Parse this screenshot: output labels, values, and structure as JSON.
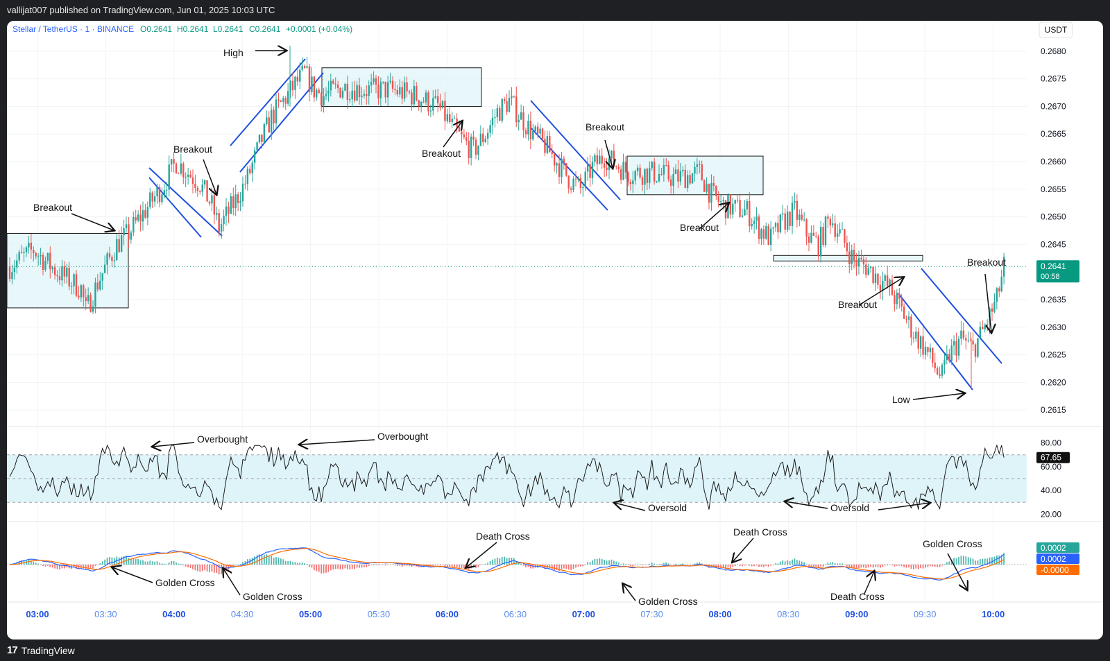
{
  "published_line": "vallijat007 published on TradingView.com, Jun 01, 2025 10:03 UTC",
  "footer_brand": "TradingView",
  "footer_logo_text": "17",
  "colors": {
    "up": "#26a69a",
    "down": "#ef5350",
    "channel": "#1e4fe0",
    "box": "#dff4f8",
    "accent_price": "#089981",
    "macd_fast": "#2962ff",
    "macd_slow": "#ff6d00",
    "rsi_band": "#dff4f8"
  },
  "chart_data": [
    {
      "type": "candlestick",
      "title": "Stellar / TetherUS · 1 · BINANCE",
      "ohlc_label": {
        "o": "O0.2641",
        "h": "H0.2641",
        "l": "L0.2641",
        "c": "C0.2641",
        "change": "+0.0001 (+0.04%)"
      },
      "currency": "USDT",
      "ylim": [
        0.2612,
        0.2683
      ],
      "yticks": [
        "0.2680",
        "0.2675",
        "0.2670",
        "0.2665",
        "0.2660",
        "0.2655",
        "0.2650",
        "0.2645",
        "0.2635",
        "0.2630",
        "0.2625",
        "0.2620",
        "0.2615"
      ],
      "last_price": "0.2641",
      "countdown": "00:58",
      "xticks": [
        "03:00",
        "03:30",
        "04:00",
        "04:30",
        "05:00",
        "05:30",
        "06:00",
        "06:30",
        "07:00",
        "07:30",
        "08:00",
        "08:30",
        "09:00",
        "09:30",
        "10:00"
      ],
      "bold_xticks": [
        "03:00",
        "04:00",
        "05:00",
        "06:00",
        "07:00",
        "08:00",
        "09:00",
        "10:00"
      ],
      "close_path": [
        [
          0,
          0.2641
        ],
        [
          10,
          0.2644
        ],
        [
          20,
          0.264
        ],
        [
          30,
          0.2637
        ],
        [
          32,
          0.2633
        ],
        [
          38,
          0.2639
        ],
        [
          45,
          0.2645
        ],
        [
          50,
          0.2647
        ],
        [
          55,
          0.265
        ],
        [
          60,
          0.2653
        ],
        [
          65,
          0.2656
        ],
        [
          70,
          0.266
        ],
        [
          75,
          0.2658
        ],
        [
          80,
          0.2656
        ],
        [
          85,
          0.2652
        ],
        [
          88,
          0.2648
        ],
        [
          95,
          0.2653
        ],
        [
          100,
          0.2657
        ],
        [
          105,
          0.2663
        ],
        [
          110,
          0.2668
        ],
        [
          115,
          0.2671
        ],
        [
          120,
          0.2674
        ],
        [
          124,
          0.2676
        ],
        [
          128,
          0.2673
        ],
        [
          132,
          0.2672
        ],
        [
          140,
          0.26735
        ],
        [
          150,
          0.2673
        ],
        [
          160,
          0.2673
        ],
        [
          170,
          0.2672
        ],
        [
          180,
          0.267
        ],
        [
          185,
          0.2667
        ],
        [
          190,
          0.2664
        ],
        [
          195,
          0.2662
        ],
        [
          200,
          0.2665
        ],
        [
          205,
          0.2669
        ],
        [
          210,
          0.2671
        ],
        [
          215,
          0.2668
        ],
        [
          220,
          0.2665
        ],
        [
          225,
          0.2663
        ],
        [
          230,
          0.266
        ],
        [
          235,
          0.2657
        ],
        [
          240,
          0.2655
        ],
        [
          245,
          0.2659
        ],
        [
          250,
          0.2661
        ],
        [
          260,
          0.2658
        ],
        [
          270,
          0.2658
        ],
        [
          280,
          0.2657
        ],
        [
          290,
          0.2658
        ],
        [
          295,
          0.2654
        ],
        [
          300,
          0.2652
        ],
        [
          310,
          0.2651
        ],
        [
          315,
          0.2648
        ],
        [
          320,
          0.2646
        ],
        [
          325,
          0.2649
        ],
        [
          330,
          0.2651
        ],
        [
          335,
          0.2647
        ],
        [
          340,
          0.2645
        ],
        [
          345,
          0.265
        ],
        [
          350,
          0.2646
        ],
        [
          355,
          0.2642
        ],
        [
          360,
          0.2641
        ],
        [
          365,
          0.2639
        ],
        [
          370,
          0.2637
        ],
        [
          375,
          0.2633
        ],
        [
          380,
          0.2629
        ],
        [
          385,
          0.2626
        ],
        [
          390,
          0.2622
        ],
        [
          392,
          0.2621
        ],
        [
          395,
          0.2625
        ],
        [
          400,
          0.2628
        ],
        [
          405,
          0.2626
        ],
        [
          410,
          0.263
        ],
        [
          415,
          0.2635
        ],
        [
          418,
          0.2641
        ]
      ],
      "annotations": [
        {
          "text": "Breakout",
          "kind": "breakout"
        },
        {
          "text": "Breakout",
          "kind": "breakout"
        },
        {
          "text": "High",
          "kind": "high"
        },
        {
          "text": "Breakout",
          "kind": "breakout"
        },
        {
          "text": "Breakout",
          "kind": "breakout"
        },
        {
          "text": "Breakout",
          "kind": "breakout"
        },
        {
          "text": "Breakout",
          "kind": "breakout"
        },
        {
          "text": "Breakout",
          "kind": "breakout"
        },
        {
          "text": "Low",
          "kind": "low"
        }
      ]
    },
    {
      "type": "line",
      "name": "RSI",
      "ylim": [
        15,
        85
      ],
      "yticks": [
        "80.00",
        "60.00",
        "40.00",
        "20.00"
      ],
      "bands": [
        70,
        50,
        30
      ],
      "last_value": "67.65",
      "annotations": [
        {
          "text": "Overbought"
        },
        {
          "text": "Overbought"
        },
        {
          "text": "Oversold"
        },
        {
          "text": "Oversold"
        }
      ]
    },
    {
      "type": "line",
      "name": "MACD",
      "value_labels": [
        {
          "text": "0.0002",
          "color": "#26a69a"
        },
        {
          "text": "0.0002",
          "color": "#2962ff"
        },
        {
          "text": "-0.0000",
          "color": "#ff6d00"
        }
      ],
      "annotations": [
        {
          "text": "Golden Cross"
        },
        {
          "text": "Golden Cross"
        },
        {
          "text": "Death Cross"
        },
        {
          "text": "Golden Cross"
        },
        {
          "text": "Death Cross"
        },
        {
          "text": "Death Cross"
        },
        {
          "text": "Golden Cross"
        }
      ]
    }
  ]
}
